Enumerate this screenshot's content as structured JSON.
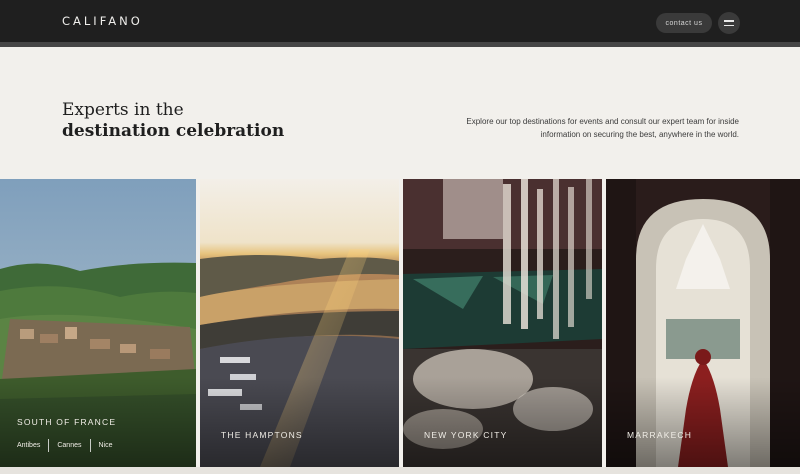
{
  "header": {
    "logo": "CALIFANO",
    "contact_label": "contact us",
    "menu_icon": "hamburger-menu-icon"
  },
  "intro": {
    "headline_line1": "Experts in the",
    "headline_line2": "destination celebration",
    "description": "Explore our top destinations for events and consult our expert team for inside information on securing the best, anywhere in the world."
  },
  "destinations": [
    {
      "name": "SOUTH OF FRANCE",
      "cities": [
        "Antibes",
        "Cannes",
        "Nice"
      ]
    },
    {
      "name": "THE HAMPTONS"
    },
    {
      "name": "NEW YORK CITY"
    },
    {
      "name": "MARRAKECH"
    }
  ],
  "colors": {
    "header_bg": "#1f1f1f",
    "page_bg": "#f2f0ec",
    "text_dark": "#1f1f1f",
    "card_label": "#f0ede6"
  }
}
